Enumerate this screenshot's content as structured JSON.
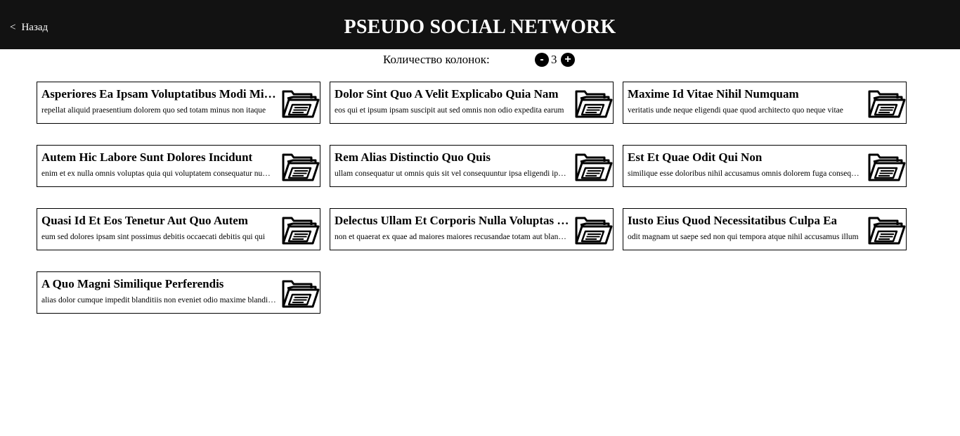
{
  "header": {
    "back_chevron": "<",
    "back_label": "Назад",
    "title": "PSEUDO SOCIAL NETWORK"
  },
  "columns_control": {
    "label": "Количество колонок:",
    "minus": "-",
    "value": "3",
    "plus": "+"
  },
  "cards": [
    {
      "title": "Asperiores Ea Ipsam Voluptatibus Modi Minima",
      "body": "repellat aliquid praesentium dolorem quo sed totam minus non itaque",
      "icon": "folder-document-icon"
    },
    {
      "title": "Dolor Sint Quo A Velit Explicabo Quia Nam",
      "body": "eos qui et ipsum ipsam suscipit aut sed omnis non odio expedita earum",
      "icon": "folder-document-icon"
    },
    {
      "title": "Maxime Id Vitae Nihil Numquam",
      "body": "veritatis unde neque eligendi quae quod architecto quo neque vitae",
      "icon": "folder-document-icon"
    },
    {
      "title": "Autem Hic Labore Sunt Dolores Incidunt",
      "body": "enim et ex nulla omnis voluptas quia qui voluptatem consequatur numquam",
      "icon": "folder-document-icon"
    },
    {
      "title": "Rem Alias Distinctio Quo Quis",
      "body": "ullam consequatur ut omnis quis sit vel consequuntur ipsa eligendi ipsum",
      "icon": "folder-document-icon"
    },
    {
      "title": "Est Et Quae Odit Qui Non",
      "body": "similique esse doloribus nihil accusamus omnis dolorem fuga consequuntur",
      "icon": "folder-document-icon"
    },
    {
      "title": "Quasi Id Et Eos Tenetur Aut Quo Autem",
      "body": "eum sed dolores ipsam sint possimus debitis occaecati debitis qui qui",
      "icon": "folder-document-icon"
    },
    {
      "title": "Delectus Ullam Et Corporis Nulla Voluptas Sequi",
      "body": "non et quaerat ex quae ad maiores maiores recusandae totam aut blanditiis",
      "icon": "folder-document-icon"
    },
    {
      "title": "Iusto Eius Quod Necessitatibus Culpa Ea",
      "body": "odit magnam ut saepe sed non qui tempora atque nihil accusamus illum",
      "icon": "folder-document-icon"
    },
    {
      "title": "A Quo Magni Similique Perferendis",
      "body": "alias dolor cumque impedit blanditiis non eveniet odio maxime blanditiis",
      "icon": "folder-document-icon"
    }
  ]
}
